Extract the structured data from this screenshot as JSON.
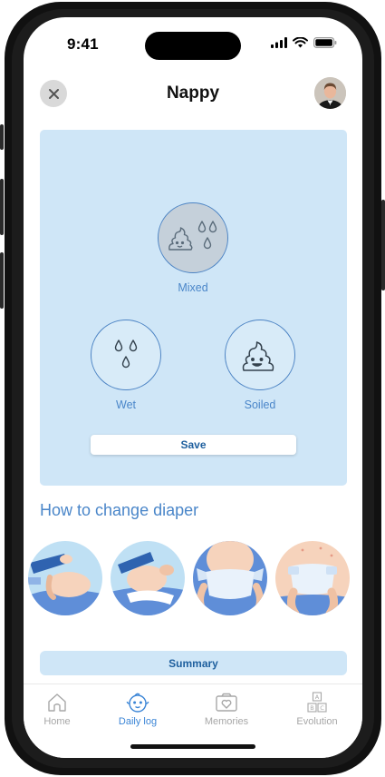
{
  "status_bar": {
    "time": "9:41"
  },
  "header": {
    "title": "Nappy"
  },
  "options": [
    {
      "label": "Mixed",
      "icon": "poop-drops-icon",
      "selected": true
    },
    {
      "label": "Wet",
      "icon": "drops-icon",
      "selected": false
    },
    {
      "label": "Soiled",
      "icon": "poop-icon",
      "selected": false
    }
  ],
  "save_label": "Save",
  "guide": {
    "title": "How to change diaper",
    "steps": [
      "step-1",
      "step-2",
      "step-3",
      "step-4"
    ]
  },
  "summary_label": "Summary",
  "tabs": [
    {
      "label": "Home",
      "icon": "house-icon",
      "active": false
    },
    {
      "label": "Daily log",
      "icon": "baby-face-icon",
      "active": true
    },
    {
      "label": "Memories",
      "icon": "photo-heart-icon",
      "active": false
    },
    {
      "label": "Evolution",
      "icon": "abc-blocks-icon",
      "active": false
    }
  ],
  "colors": {
    "accent": "#4a86c9",
    "card_bg": "#cfe6f7",
    "active_tab": "#3b85d6",
    "inactive_tab": "#a7a7a7"
  }
}
